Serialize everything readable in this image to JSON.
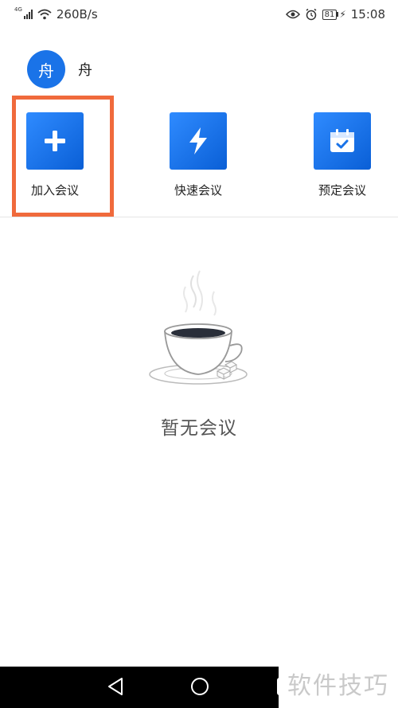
{
  "status_bar": {
    "network_type": "4G",
    "speed": "260B/s",
    "battery": "81",
    "time": "15:08",
    "icons": [
      "signal-icon",
      "wifi-icon",
      "eye-icon",
      "alarm-icon",
      "battery-icon",
      "charging-icon"
    ]
  },
  "user": {
    "avatar_char": "舟",
    "name": "舟"
  },
  "actions": [
    {
      "label": "加入会议",
      "icon": "plus-icon"
    },
    {
      "label": "快速会议",
      "icon": "lightning-icon"
    },
    {
      "label": "预定会议",
      "icon": "calendar-check-icon"
    }
  ],
  "highlight_color": "#f06a3c",
  "accent_color": "#1a73e8",
  "empty_state": {
    "icon": "coffee-cup-icon",
    "text": "暂无会议"
  },
  "nav_bar": {
    "buttons": [
      "back-icon",
      "home-icon",
      "recent-apps-icon"
    ]
  },
  "watermark": "软件技巧"
}
